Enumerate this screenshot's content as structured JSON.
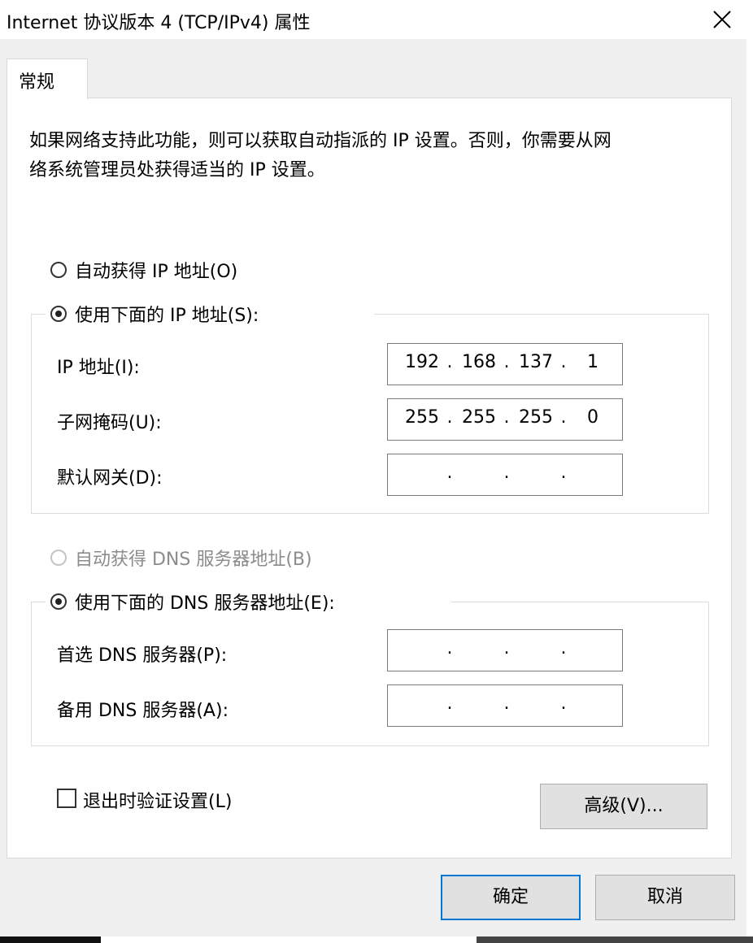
{
  "window": {
    "title": "Internet 协议版本 4 (TCP/IPv4) 属性",
    "close_symbol": "✕"
  },
  "tabs": [
    {
      "label": "常规",
      "selected": true
    }
  ],
  "description": {
    "line1": "如果网络支持此功能，则可以获取自动指派的 IP 设置。否则，你需要从网",
    "line2": "络系统管理员处获得适当的 IP 设置。"
  },
  "ip_section": {
    "auto_label": "自动获得 IP 地址(O)",
    "auto_checked": false,
    "manual_label": "使用下面的 IP 地址(S):",
    "manual_checked": true,
    "fields": [
      {
        "label": "IP 地址(I):",
        "octets": [
          "192",
          "168",
          "137",
          "1"
        ]
      },
      {
        "label": "子网掩码(U):",
        "octets": [
          "255",
          "255",
          "255",
          "0"
        ]
      },
      {
        "label": "默认网关(D):",
        "octets": [
          "",
          "",
          "",
          ""
        ]
      }
    ]
  },
  "dns_section": {
    "auto_label": "自动获得 DNS 服务器地址(B)",
    "auto_checked": false,
    "auto_disabled": true,
    "manual_label": "使用下面的 DNS 服务器地址(E):",
    "manual_checked": true,
    "fields": [
      {
        "label": "首选 DNS 服务器(P):",
        "octets": [
          "",
          "",
          "",
          ""
        ]
      },
      {
        "label": "备用 DNS 服务器(A):",
        "octets": [
          "",
          "",
          "",
          ""
        ]
      }
    ]
  },
  "validate_on_exit": {
    "label": "退出时验证设置(L)",
    "checked": false
  },
  "buttons": {
    "advanced": "高级(V)...",
    "ok": "确定",
    "cancel": "取消"
  },
  "colors": {
    "default_button_border": "#0078d7",
    "disabled_text": "#8c8c8c"
  }
}
